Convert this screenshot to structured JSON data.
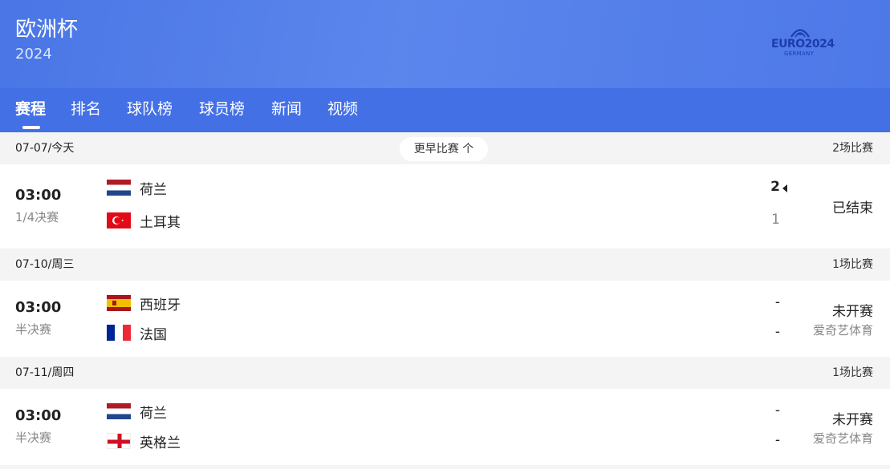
{
  "header": {
    "title": "欧洲杯",
    "subtitle": "2024",
    "logo": {
      "brand": "EURO2024",
      "host": "GERMANY"
    }
  },
  "tabs": [
    {
      "label": "赛程",
      "active": true
    },
    {
      "label": "排名",
      "active": false
    },
    {
      "label": "球队榜",
      "active": false
    },
    {
      "label": "球员榜",
      "active": false
    },
    {
      "label": "新闻",
      "active": false
    },
    {
      "label": "视频",
      "active": false
    }
  ],
  "earlier_button": "更早比赛 个",
  "days": [
    {
      "date": "07-07/今天",
      "count": "2场比赛",
      "match": {
        "time": "03:00",
        "stage": "1/4决赛",
        "home": {
          "name": "荷兰",
          "flag": "netherlands-flag",
          "score": "2"
        },
        "away": {
          "name": "土耳其",
          "flag": "turkey-flag",
          "score": "1"
        },
        "status": "已结束"
      }
    },
    {
      "date": "07-10/周三",
      "count": "1场比赛",
      "match": {
        "time": "03:00",
        "stage": "半决赛",
        "home": {
          "name": "西班牙",
          "flag": "spain-flag",
          "score": "-"
        },
        "away": {
          "name": "法国",
          "flag": "france-flag",
          "score": "-"
        },
        "status": "未开赛",
        "broadcaster": "爱奇艺体育"
      }
    },
    {
      "date": "07-11/周四",
      "count": "1场比赛",
      "match": {
        "time": "03:00",
        "stage": "半决赛",
        "home": {
          "name": "荷兰",
          "flag": "netherlands-flag",
          "score": "-"
        },
        "away": {
          "name": "英格兰",
          "flag": "england-flag",
          "score": "-"
        },
        "status": "未开赛",
        "broadcaster": "爱奇艺体育"
      }
    }
  ],
  "colors": {
    "header_blue": "#4a76e6",
    "tab_bar_blue": "#4470e6",
    "logo_navy": "#1e3cad",
    "muted_text": "#888888"
  }
}
